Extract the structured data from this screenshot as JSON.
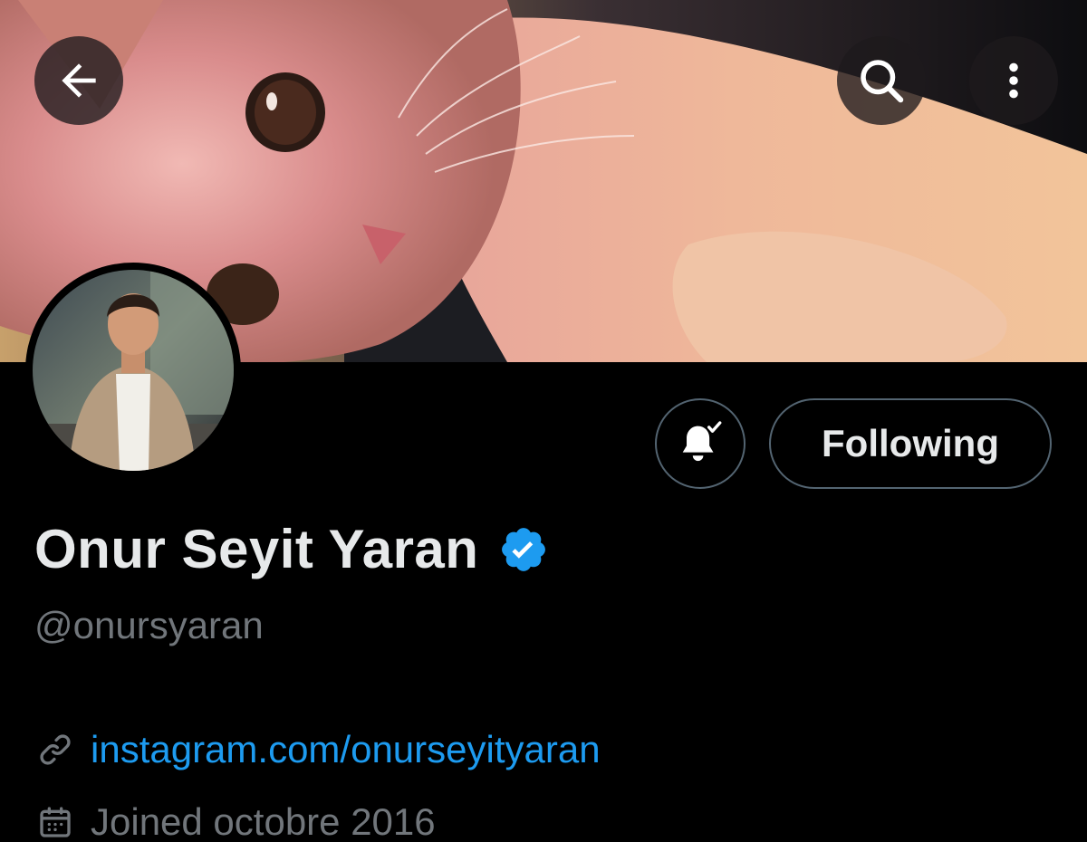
{
  "header": {
    "back_icon": "arrow-left-icon",
    "search_icon": "search-icon",
    "more_icon": "more-vertical-icon"
  },
  "banner": {
    "description_icon": "banner-image"
  },
  "profile": {
    "display_name": "Onur Seyit Yaran",
    "handle": "@onursyaran",
    "verified_icon": "verified-badge-icon",
    "verified_color": "#1d9bf0",
    "link_icon": "link-icon",
    "link": "instagram.com/onurseyityaran",
    "joined_icon": "calendar-icon",
    "joined": "Joined octobre 2016"
  },
  "actions": {
    "notify_icon": "bell-check-icon",
    "following_label": "Following"
  },
  "colors": {
    "background": "#000000",
    "text_primary": "#e7e9ea",
    "text_secondary": "#71767b",
    "link": "#1d9bf0",
    "border": "#536471"
  }
}
